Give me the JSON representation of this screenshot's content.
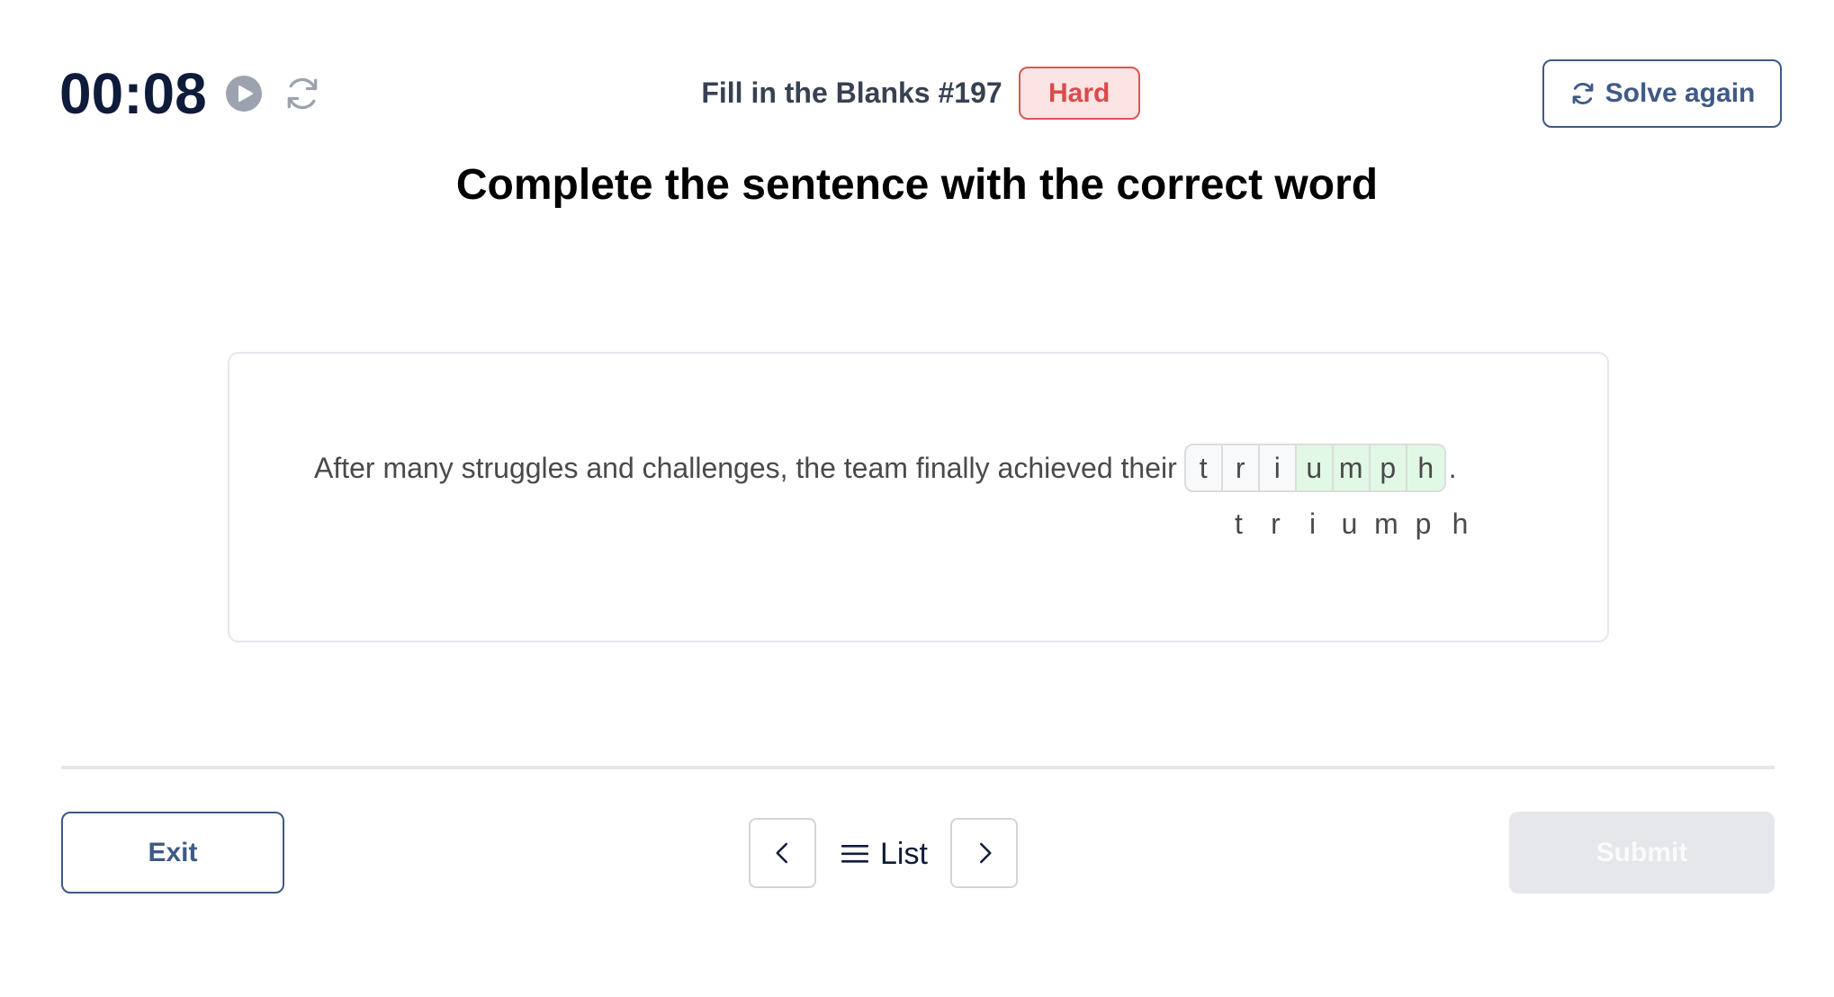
{
  "timer": {
    "value": "00:08",
    "play_icon": "play-circle-icon",
    "reset_icon": "refresh-icon"
  },
  "header": {
    "title": "Fill in the Blanks #197",
    "difficulty": "Hard",
    "solve_again_label": "Solve again",
    "solve_again_icon": "refresh-icon"
  },
  "colors": {
    "primary": "#3e5a85",
    "timer_text": "#0f1b3a",
    "badge_text": "#dc4a4a",
    "badge_bg": "#fce4e4",
    "filled_cell": "#e2f8e7",
    "empty_cell": "#f8f9fb",
    "submit_disabled_bg": "#e5e7eb"
  },
  "instruction": "Complete the sentence with the correct word",
  "question": {
    "sentence_before": "After many struggles and challenges, the team finally achieved their",
    "sentence_after": ".",
    "cells": [
      {
        "letter": "t",
        "state": "given"
      },
      {
        "letter": "r",
        "state": "given"
      },
      {
        "letter": "i",
        "state": "given"
      },
      {
        "letter": "u",
        "state": "filled"
      },
      {
        "letter": "m",
        "state": "filled"
      },
      {
        "letter": "p",
        "state": "filled"
      },
      {
        "letter": "h",
        "state": "filled"
      }
    ],
    "answer_letters": [
      "t",
      "r",
      "i",
      "u",
      "m",
      "p",
      "h"
    ]
  },
  "footer": {
    "exit_label": "Exit",
    "list_label": "List",
    "list_icon": "hamburger-menu-icon",
    "prev_icon": "chevron-left-icon",
    "next_icon": "chevron-right-icon",
    "submit_label": "Submit",
    "submit_disabled": true
  }
}
